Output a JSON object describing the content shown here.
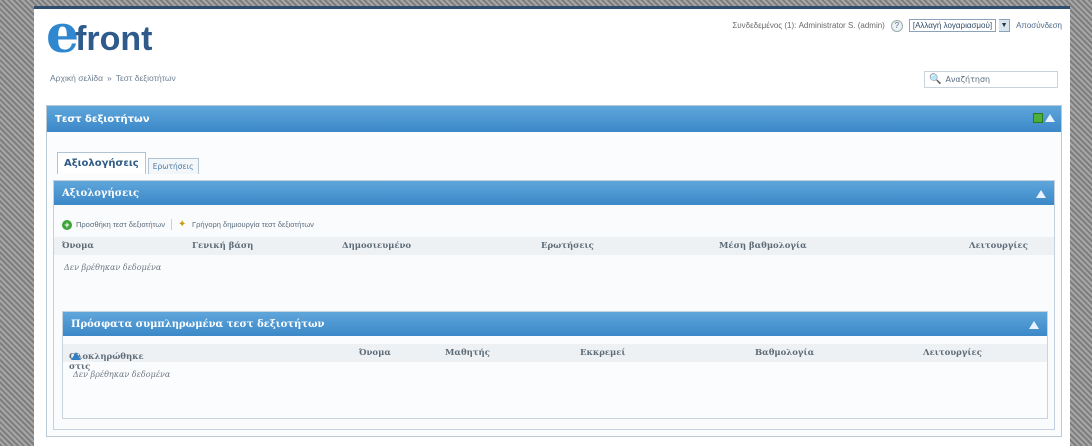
{
  "header": {
    "logo_e": "e",
    "logo_text": "front",
    "user_status": "Συνδεδεμένος (1): Administrator S. (admin)",
    "role_select_value": "[Αλλαγή λογαριασμού]",
    "logout_label": "Αποσύνδεση",
    "help_icon": "?"
  },
  "breadcrumb": {
    "home": "Αρχική σελίδα",
    "separator": "»",
    "current": "Τεστ δεξιοτήτων"
  },
  "search": {
    "placeholder": "Αναζήτηση"
  },
  "panel": {
    "title": "Τεστ δεξιοτήτων",
    "tabs": [
      {
        "label": "Αξιολογήσεις",
        "active": true
      },
      {
        "label": "Ερωτήσεις",
        "active": false
      }
    ]
  },
  "assessments": {
    "title": "Αξιολογήσεις",
    "actions": {
      "add": "Προσθήκη τεστ δεξιοτήτων",
      "quick_create": "Γρήγορη δημιουργία τεστ δεξιοτήτων"
    },
    "columns": [
      "Όνομα",
      "Γενική βάση",
      "Δημοσιευμένο",
      "Ερωτήσεις",
      "Μέση βαθμολογία",
      "Λειτουργίες"
    ],
    "empty_text": "Δεν βρέθηκαν δεδομένα"
  },
  "recent": {
    "title": "Πρόσφατα συμπληρωμένα τεστ δεξιοτήτων",
    "columns": [
      "Ολοκληρώθηκε στις",
      "Όνομα",
      "Μαθητής",
      "Εκκρεμεί",
      "Βαθμολογία",
      "Λειτουργίες"
    ],
    "empty_text": "Δεν βρέθηκαν δεδομένα"
  },
  "colors": {
    "header_blue": "#3b88c8",
    "logo_blue": "#2f87cf",
    "logo_dark": "#2e5a8c"
  }
}
